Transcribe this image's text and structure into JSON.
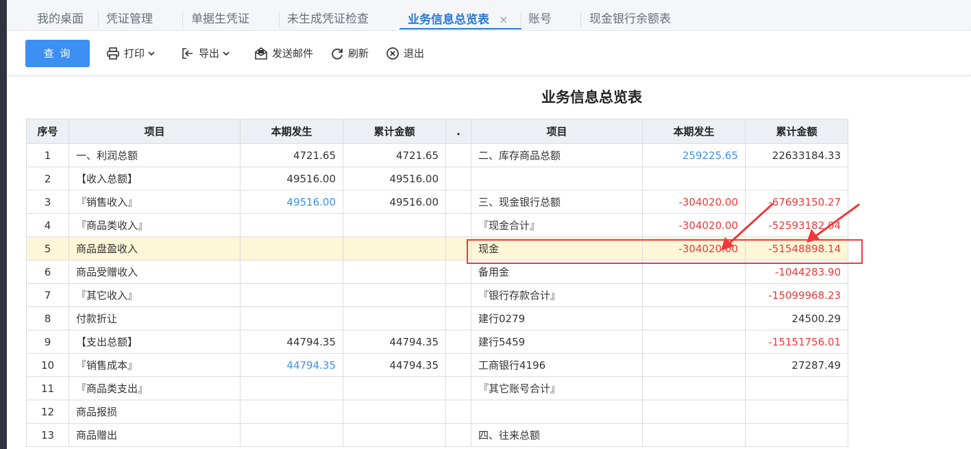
{
  "tabs": [
    {
      "label": "我的桌面",
      "active": false
    },
    {
      "label": "凭证管理",
      "active": false
    },
    {
      "label": "单据生凭证",
      "active": false
    },
    {
      "label": "未生成凭证检查",
      "active": false
    },
    {
      "label": "业务信息总览表",
      "active": true,
      "close": "×"
    },
    {
      "label": "账号",
      "active": false
    },
    {
      "label": "现金银行余额表",
      "active": false
    }
  ],
  "toolbar": {
    "query": "查 询",
    "print": "打印",
    "export": "导出",
    "send_mail": "发送邮件",
    "refresh": "刷新",
    "exit": "退出"
  },
  "report": {
    "title": "业务信息总览表",
    "headers": [
      "序号",
      "项目",
      "本期发生",
      "累计金额",
      ".",
      "项目",
      "本期发生",
      "累计金额"
    ],
    "rows": [
      {
        "no": "1",
        "item1": "一、利润总额",
        "cur1": "4721.65",
        "acc1": "4721.65",
        "item2": "二、库存商品总额",
        "cur2": "259225.65",
        "acc2": "22633184.33"
      },
      {
        "no": "2",
        "item1": "【收入总额】",
        "cur1": "49516.00",
        "acc1": "49516.00",
        "item2": "",
        "cur2": "",
        "acc2": ""
      },
      {
        "no": "3",
        "item1": "『销售收入』",
        "cur1": "49516.00",
        "acc1": "49516.00",
        "item2": "三、现金银行总额",
        "cur2": "-304020.00",
        "acc2": "-67693150.27"
      },
      {
        "no": "4",
        "item1": "『商品类收入』",
        "cur1": "",
        "acc1": "",
        "item2": "『现金合计』",
        "cur2": "-304020.00",
        "acc2": "-52593182.04"
      },
      {
        "no": "5",
        "item1": "商品盘盈收入",
        "cur1": "",
        "acc1": "",
        "item2": "现金",
        "cur2": "-304020.00",
        "acc2": "-51548898.14"
      },
      {
        "no": "6",
        "item1": "商品受赠收入",
        "cur1": "",
        "acc1": "",
        "item2": "备用金",
        "cur2": "",
        "acc2": "-1044283.90"
      },
      {
        "no": "7",
        "item1": "『其它收入』",
        "cur1": "",
        "acc1": "",
        "item2": "『银行存款合计』",
        "cur2": "",
        "acc2": "-15099968.23"
      },
      {
        "no": "8",
        "item1": "付款折让",
        "cur1": "",
        "acc1": "",
        "item2": "建行0279",
        "cur2": "",
        "acc2": "24500.29"
      },
      {
        "no": "9",
        "item1": "【支出总额】",
        "cur1": "44794.35",
        "acc1": "44794.35",
        "item2": "建行5459",
        "cur2": "",
        "acc2": "-15151756.01"
      },
      {
        "no": "10",
        "item1": "『销售成本』",
        "cur1": "44794.35",
        "acc1": "44794.35",
        "item2": "工商银行4196",
        "cur2": "",
        "acc2": "27287.49"
      },
      {
        "no": "11",
        "item1": "『商品类支出』",
        "cur1": "",
        "acc1": "",
        "item2": "『其它账号合计』",
        "cur2": "",
        "acc2": ""
      },
      {
        "no": "12",
        "item1": "商品报损",
        "cur1": "",
        "acc1": "",
        "item2": "",
        "cur2": "",
        "acc2": ""
      },
      {
        "no": "13",
        "item1": "商品赠出",
        "cur1": "",
        "acc1": "",
        "item2": "四、往来总额",
        "cur2": "",
        "acc2": ""
      }
    ]
  },
  "colors": {
    "link_blue": "#3d8ff2",
    "negative_red": "#f03838",
    "highlight_row": "#fdf6d7",
    "annotation_red": "#f03838"
  }
}
